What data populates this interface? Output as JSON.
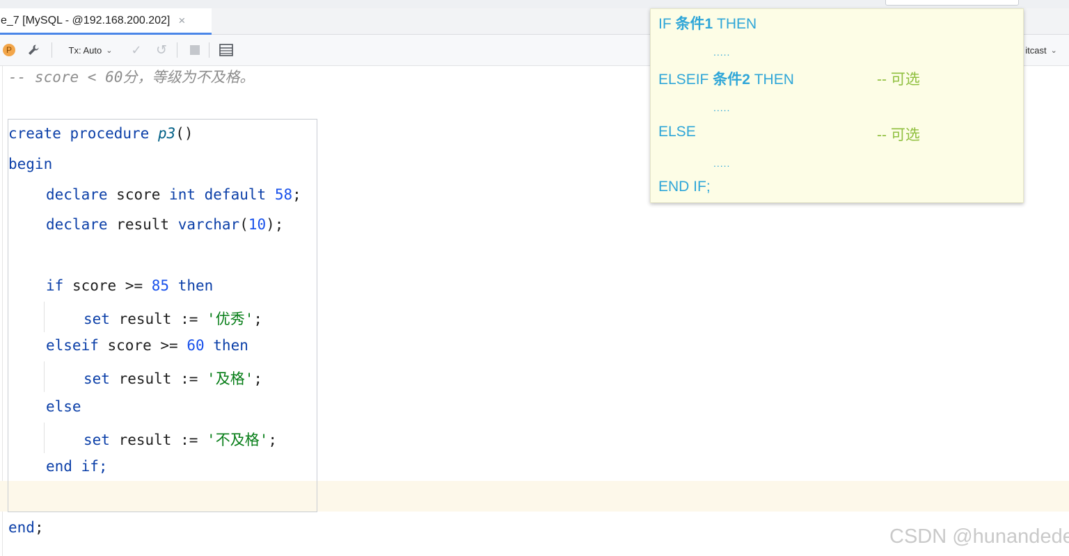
{
  "tab": {
    "title": "e_7 [MySQL - @192.168.200.202]",
    "close": "×"
  },
  "toolbar": {
    "profile_badge": "P",
    "tx_mode": "Tx: Auto",
    "schema": "itcast",
    "chevron": "⌄",
    "commit_glyph": "✓",
    "rollback_glyph": "↺"
  },
  "editor": {
    "comment_line": "-- score < 60分，等级为不及格。",
    "lines": {
      "l1_create": "create",
      "l1_procedure": "procedure",
      "l1_name": "p3",
      "l1_parens": "()",
      "l2_begin": "begin",
      "l3_declare": "declare",
      "l3_var": "score",
      "l3_type": "int",
      "l3_default": "default",
      "l3_value": "58",
      "l3_semi": ";",
      "l4_declare": "declare",
      "l4_var": "result",
      "l4_type": "varchar",
      "l4_open": "(",
      "l4_len": "10",
      "l4_close": ");",
      "l5_if": "if",
      "l5_cond": "score >=",
      "l5_num": "85",
      "l5_then": "then",
      "l6_set": "set",
      "l6_assign": "result :=",
      "l6_str": "'优秀'",
      "l6_semi": ";",
      "l7_elseif": "elseif",
      "l7_cond": "score >=",
      "l7_num": "60",
      "l7_then": "then",
      "l8_set": "set",
      "l8_assign": "result :=",
      "l8_str": "'及格'",
      "l8_semi": ";",
      "l9_else": "else",
      "l10_set": "set",
      "l10_assign": "result :=",
      "l10_str": "'不及格'",
      "l10_semi": ";",
      "l11_end": "end",
      "l11_if": "if;",
      "l12_end": "end",
      "l12_semi": ";"
    }
  },
  "syntax_popup": {
    "line1_a": "IF ",
    "line1_cn": "条件1",
    "line1_b": " THEN",
    "dots1": ".....",
    "line2_a": "ELSEIF ",
    "line2_cn": "条件2",
    "line2_b": " THEN",
    "line2_opt": "-- 可选",
    "dots2": ".....",
    "line3": "ELSE",
    "line3_opt": "-- 可选",
    "dots3": ".....",
    "line4": "END IF;"
  },
  "watermark": "CSDN @hunandede",
  "colors": {
    "keyword": "#0b3fa8",
    "number": "#1750eb",
    "string": "#067d17",
    "popup_text": "#2fa6d8",
    "popup_optional": "#8fbf3e",
    "popup_bg": "#fdfde6",
    "tab_accent": "#4a86e8"
  }
}
